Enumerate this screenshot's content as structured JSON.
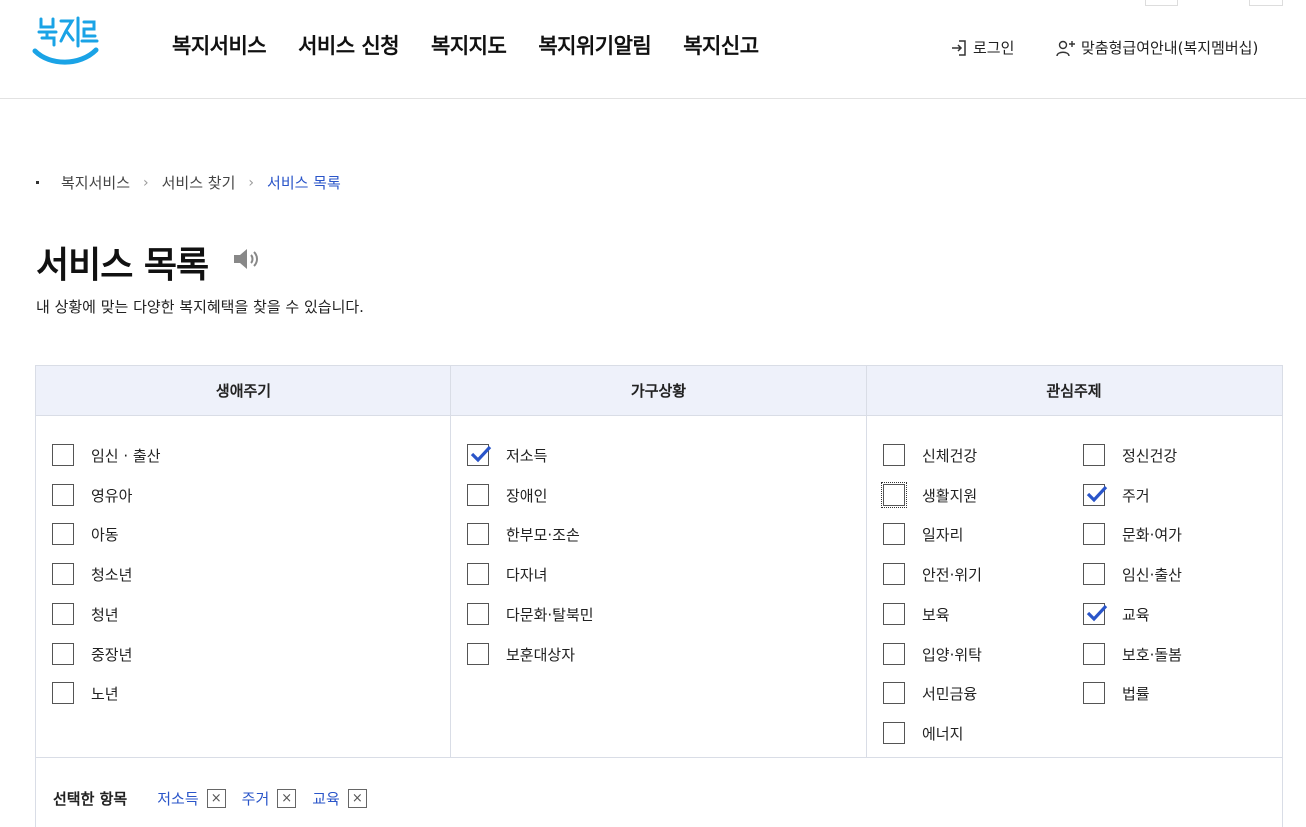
{
  "brand": {
    "logo_text": "복지로",
    "accent": "#2a55c9",
    "logo_blue": "#1aa3e6"
  },
  "gnb": [
    "복지서비스",
    "서비스 신청",
    "복지지도",
    "복지위기알림",
    "복지신고"
  ],
  "util": {
    "login": "로그인",
    "member": "맞춤형급여안내(복지멤버십)",
    "login_icon": "login-icon",
    "member_icon": "user-add-icon"
  },
  "breadcrumb": [
    "복지서비스",
    "서비스 찾기",
    "서비스 목록"
  ],
  "page": {
    "title": "서비스 목록",
    "description": "내 상황에 맞는 다양한 복지혜택을 찾을 수 있습니다.",
    "speaker_icon": "speaker-icon"
  },
  "filter": {
    "columns": [
      {
        "heading": "생애주기",
        "items": [
          {
            "label": "임신 · 출산",
            "checked": false
          },
          {
            "label": "영유아",
            "checked": false
          },
          {
            "label": "아동",
            "checked": false
          },
          {
            "label": "청소년",
            "checked": false
          },
          {
            "label": "청년",
            "checked": false
          },
          {
            "label": "중장년",
            "checked": false
          },
          {
            "label": "노년",
            "checked": false
          }
        ]
      },
      {
        "heading": "가구상황",
        "items": [
          {
            "label": "저소득",
            "checked": true
          },
          {
            "label": "장애인",
            "checked": false
          },
          {
            "label": "한부모·조손",
            "checked": false
          },
          {
            "label": "다자녀",
            "checked": false
          },
          {
            "label": "다문화·탈북민",
            "checked": false
          },
          {
            "label": "보훈대상자",
            "checked": false
          }
        ]
      },
      {
        "heading": "관심주제",
        "items": [
          {
            "label": "신체건강",
            "checked": false
          },
          {
            "label": "정신건강",
            "checked": false
          },
          {
            "label": "생활지원",
            "checked": false,
            "focused": true
          },
          {
            "label": "주거",
            "checked": true
          },
          {
            "label": "일자리",
            "checked": false
          },
          {
            "label": "문화·여가",
            "checked": false
          },
          {
            "label": "안전·위기",
            "checked": false
          },
          {
            "label": "임신·출산",
            "checked": false
          },
          {
            "label": "보육",
            "checked": false
          },
          {
            "label": "교육",
            "checked": true
          },
          {
            "label": "입양·위탁",
            "checked": false
          },
          {
            "label": "보호·돌봄",
            "checked": false
          },
          {
            "label": "서민금융",
            "checked": false
          },
          {
            "label": "법률",
            "checked": false
          },
          {
            "label": "에너지",
            "checked": false
          }
        ]
      }
    ],
    "selected_title": "선택한 항목",
    "selected": [
      "저소득",
      "주거",
      "교육"
    ],
    "remove_symbol": "×"
  }
}
